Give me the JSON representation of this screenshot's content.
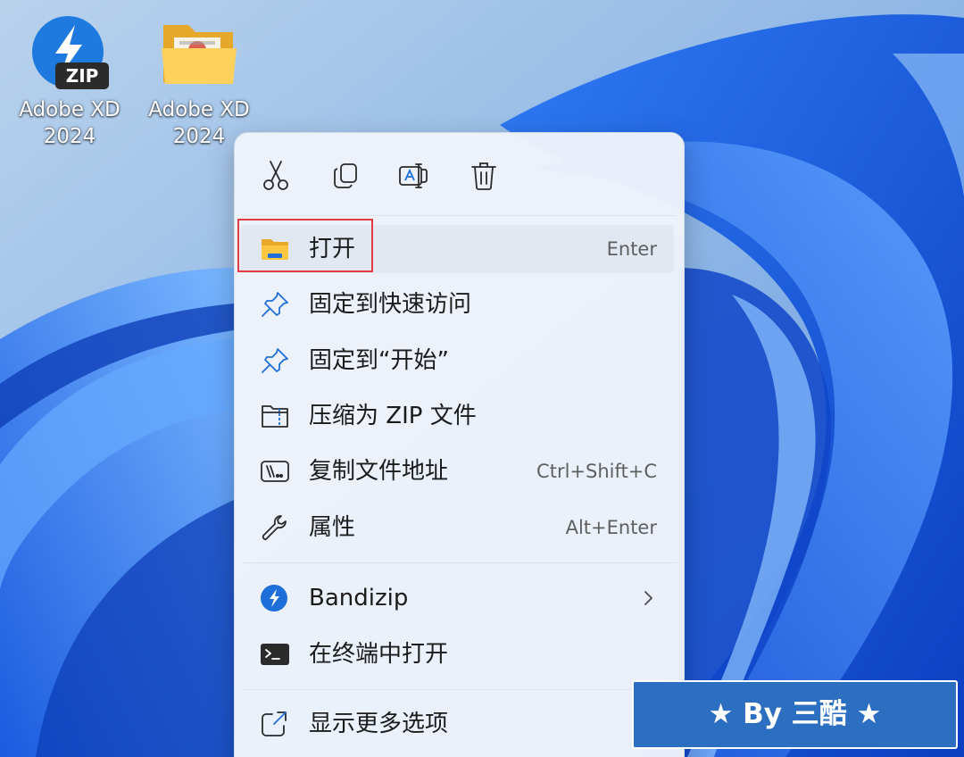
{
  "desktop": {
    "icons": [
      {
        "label": "Adobe XD\n2024",
        "icon": "bandizip-zip-icon"
      },
      {
        "label": "Adobe XD\n2024",
        "icon": "folder-icon"
      }
    ],
    "zip_icon_text": "ZIP"
  },
  "context_menu": {
    "toolbar": [
      {
        "name": "cut",
        "icon": "scissors-icon"
      },
      {
        "name": "copy",
        "icon": "copy-icon"
      },
      {
        "name": "rename",
        "icon": "rename-icon"
      },
      {
        "name": "delete",
        "icon": "trash-icon"
      }
    ],
    "items": [
      {
        "label": "打开",
        "shortcut": "Enter",
        "icon": "folder-open-icon"
      },
      {
        "label": "固定到快速访问",
        "shortcut": "",
        "icon": "pin-icon"
      },
      {
        "label": "固定到“开始”",
        "shortcut": "",
        "icon": "pin-icon"
      },
      {
        "label": "压缩为 ZIP 文件",
        "shortcut": "",
        "icon": "zip-folder-icon"
      },
      {
        "label": "复制文件地址",
        "shortcut": "Ctrl+Shift+C",
        "icon": "copy-path-icon"
      },
      {
        "label": "属性",
        "shortcut": "Alt+Enter",
        "icon": "wrench-icon"
      },
      {
        "label": "Bandizip",
        "shortcut": "",
        "icon": "bandizip-icon"
      },
      {
        "label": "在终端中打开",
        "shortcut": "",
        "icon": "terminal-icon"
      },
      {
        "label": "显示更多选项",
        "shortcut": "",
        "icon": "external-link-icon"
      }
    ]
  },
  "watermark": {
    "text": "★ By 三酷 ★"
  },
  "colors": {
    "accent": "#1e6fd9",
    "highlight_border": "#e33b44",
    "badge_bg": "#2c6fc0",
    "menu_bg": "#eef3fa"
  }
}
